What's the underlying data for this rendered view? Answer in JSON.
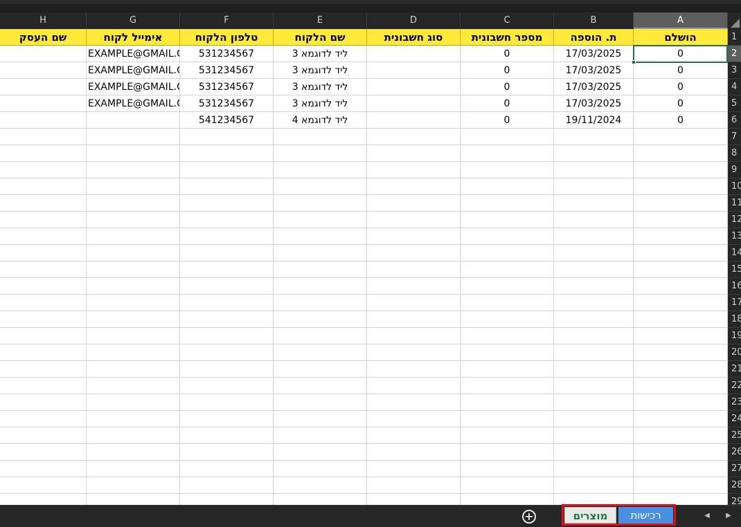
{
  "columns": [
    "H",
    "G",
    "F",
    "E",
    "D",
    "C",
    "B",
    "A"
  ],
  "selected_column": "A",
  "header_row": [
    "שם העסק",
    "אימייל לקוח",
    "טלפון הלקוח",
    "שם הלקוח",
    "סוג חשבונית",
    "מספר חשבונית",
    "ת. הוספה",
    "הושלם"
  ],
  "rows": [
    [
      "",
      "EXAMPLE@GMAIL.COM",
      "531234567",
      "ליד לדוגמא 3",
      "",
      "0",
      "17/03/2025",
      "0"
    ],
    [
      "",
      "EXAMPLE@GMAIL.COM",
      "531234567",
      "ליד לדוגמא 3",
      "",
      "0",
      "17/03/2025",
      "0"
    ],
    [
      "",
      "EXAMPLE@GMAIL.COM",
      "531234567",
      "ליד לדוגמא 3",
      "",
      "0",
      "17/03/2025",
      "0"
    ],
    [
      "",
      "EXAMPLE@GMAIL.COM",
      "531234567",
      "ליד לדוגמא 3",
      "",
      "0",
      "17/03/2025",
      "0"
    ],
    [
      "",
      "",
      "541234567",
      "ליד לדוגמא 4",
      "",
      "0",
      "19/11/2024",
      "0"
    ]
  ],
  "row_numbers": [
    "1",
    "2",
    "3",
    "4",
    "5",
    "6",
    "7",
    "8",
    "9",
    "10",
    "11",
    "12",
    "13",
    "14",
    "15",
    "16",
    "17",
    "18",
    "19",
    "20",
    "21",
    "22",
    "23",
    "24",
    "25",
    "26",
    "27",
    "28",
    "29"
  ],
  "selected_row": "2",
  "sheet_tabs": {
    "add_symbol": "+",
    "products": "מוצרים",
    "purchases": "רכישות"
  },
  "nav": {
    "prev": "◀",
    "next": "▶"
  },
  "colors": {
    "header_fill": "#ffe93b",
    "selection": "#217346",
    "active_tab": "#4a90e2",
    "tab_outline": "#e01010"
  }
}
